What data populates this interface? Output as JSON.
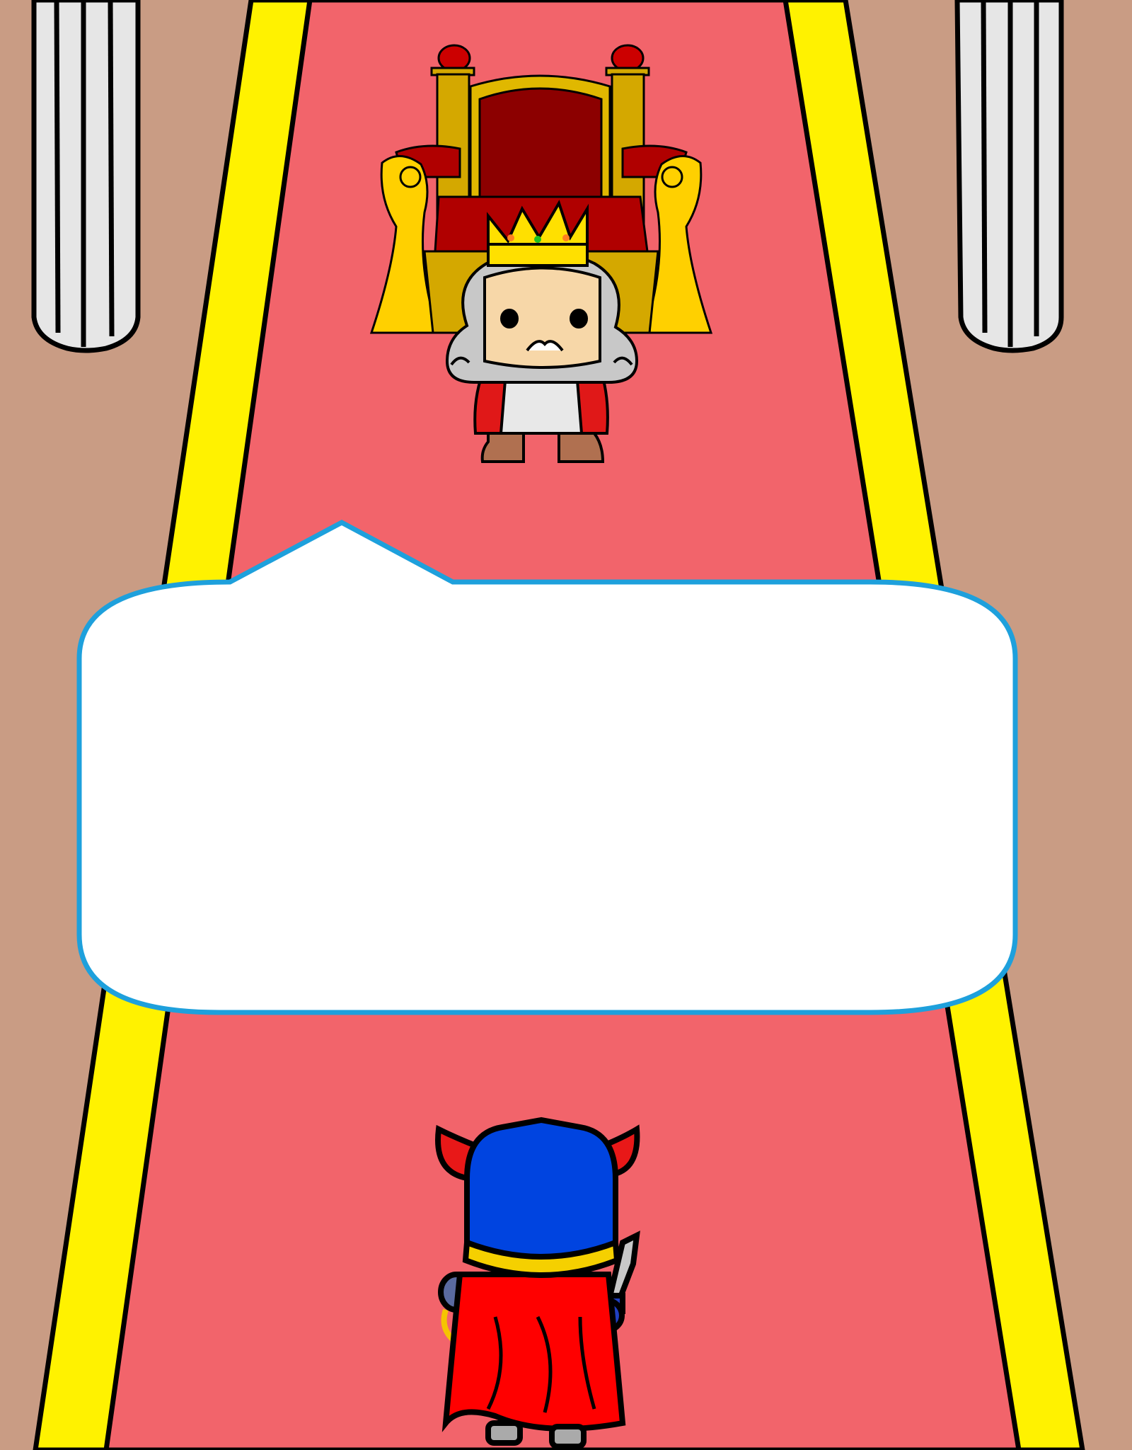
{
  "scene": {
    "type": "throne-room",
    "colors": {
      "wall": "#c99c84",
      "carpet": "#f2646b",
      "carpet_trim": "#fff200",
      "outline": "#000000",
      "pillar": "#e6e6e6",
      "throne_gold": "#d4a800",
      "throne_velvet": "#8c0000",
      "bubble_fill": "#ffffff",
      "bubble_border": "#1ea0dc",
      "hero_helmet": "#0044e0",
      "hero_horn": "#e81818",
      "hero_cape": "#ff0000"
    },
    "characters": [
      {
        "role": "king",
        "icon": "king-character-icon"
      },
      {
        "role": "hero",
        "icon": "hero-knight-back-icon"
      }
    ],
    "props": [
      "throne-icon",
      "pillar-left",
      "pillar-right"
    ]
  },
  "dialog": {
    "speaker": "king",
    "text": ""
  }
}
